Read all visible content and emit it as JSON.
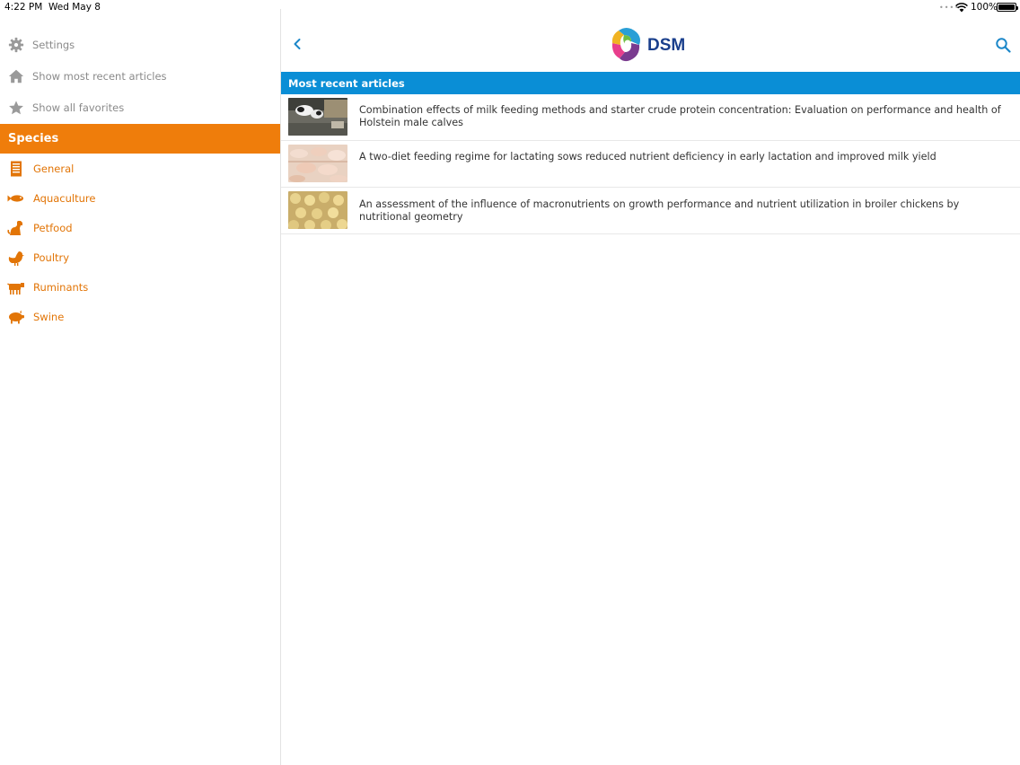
{
  "status_bar": {
    "time": "4:22 PM",
    "date": "Wed May 8",
    "battery": "100%"
  },
  "sidebar": {
    "top_items": [
      {
        "label": "Settings",
        "icon": "gear-icon"
      },
      {
        "label": "Show most recent articles",
        "icon": "home-icon"
      },
      {
        "label": "Show all favorites",
        "icon": "star-icon"
      }
    ],
    "species_header": "Species",
    "species": [
      {
        "label": "General",
        "icon": "document-icon"
      },
      {
        "label": "Aquaculture",
        "icon": "fish-icon"
      },
      {
        "label": "Petfood",
        "icon": "dog-icon"
      },
      {
        "label": "Poultry",
        "icon": "chicken-icon"
      },
      {
        "label": "Ruminants",
        "icon": "cow-icon"
      },
      {
        "label": "Swine",
        "icon": "pig-icon"
      }
    ]
  },
  "header": {
    "logo_text": "DSM"
  },
  "main": {
    "section_title": "Most recent articles",
    "articles": [
      {
        "title": "Combination effects of milk feeding methods and starter crude protein concentration: Evaluation on performance and health of Holstein male calves"
      },
      {
        "title": "A two-diet feeding regime for lactating sows reduced nutrient deficiency in early lactation and improved milk yield"
      },
      {
        "title": "An assessment of the influence of macronutrients on growth performance and nutrient utilization in broiler chickens by nutritional geometry"
      }
    ]
  },
  "colors": {
    "accent_orange": "#ef7d0b",
    "section_blue": "#0a8ed6",
    "icon_blue": "#1b87c9",
    "logo_navy": "#1a3f8c"
  }
}
